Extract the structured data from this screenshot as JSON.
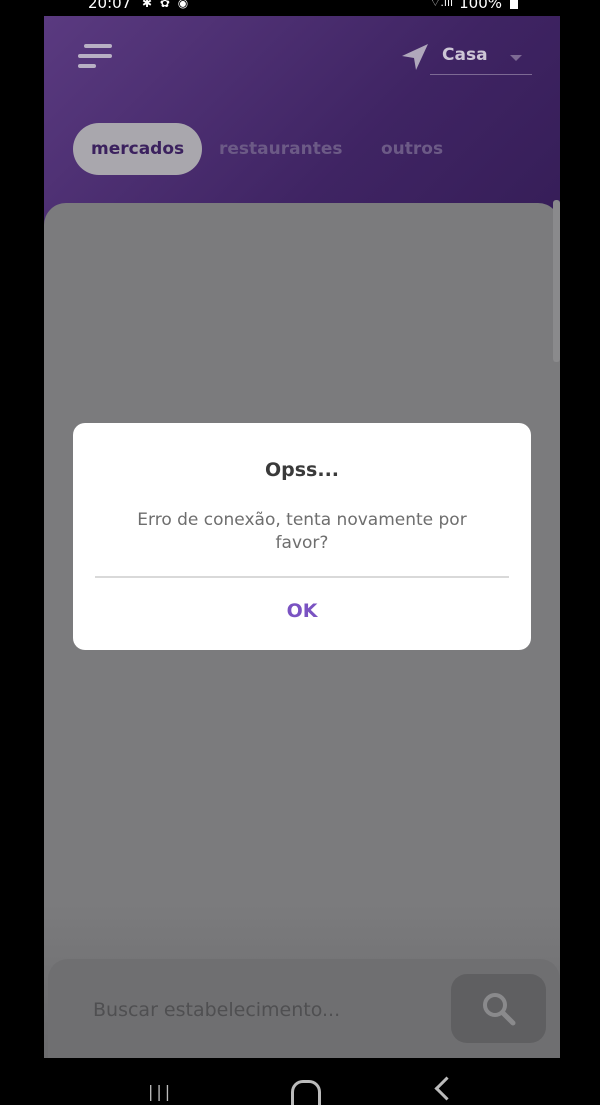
{
  "status_bar": {
    "time": "20:07",
    "left_icons": "✱ ✿ ◉",
    "signal": "⌔.ıll",
    "battery": "100%"
  },
  "header": {
    "menu_icon": "menu-lines-icon",
    "location_icon": "navigation-arrow-icon",
    "location_value": "Casa"
  },
  "tabs": [
    {
      "label": "mercados",
      "active": true
    },
    {
      "label": "restaurantes",
      "active": false
    },
    {
      "label": "outros",
      "active": false
    }
  ],
  "search": {
    "placeholder": "Buscar estabelecimento...",
    "icon": "search-icon"
  },
  "dialog": {
    "title": "Opss...",
    "message": "Erro de conexão, tenta novamente por favor?",
    "ok_label": "OK"
  },
  "colors": {
    "header": "#3f2463",
    "accent": "#7a53c2",
    "overlay": "#7b7b7d"
  }
}
